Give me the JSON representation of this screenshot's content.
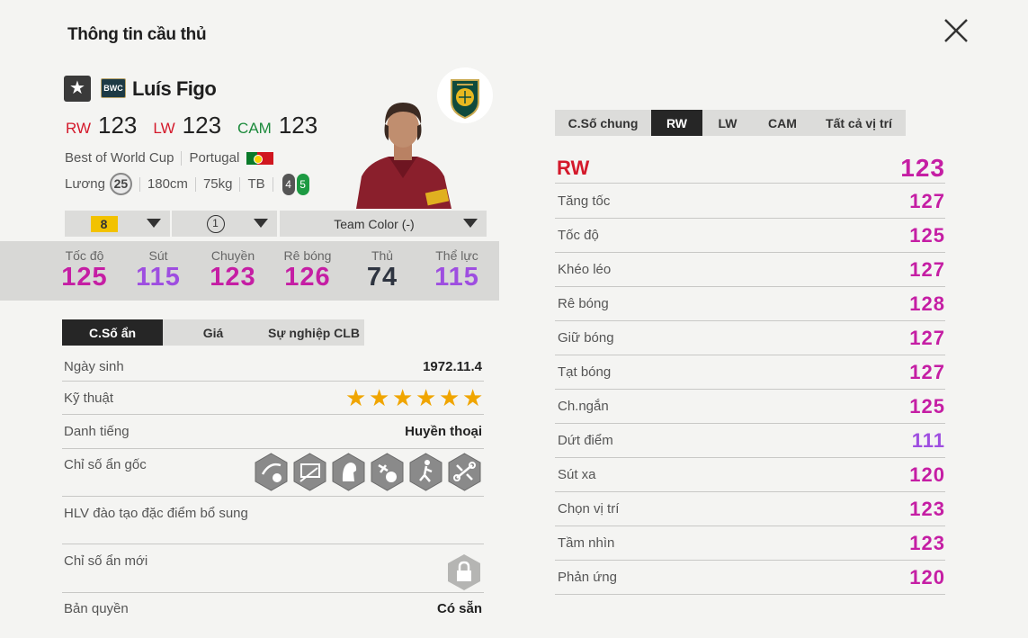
{
  "header": {
    "title": "Thông tin cầu thủ"
  },
  "player": {
    "star_icon": "star-icon",
    "season_badge": "BWC",
    "name": "Luís Figo",
    "positions": [
      {
        "pos": "RW",
        "ovr": "123",
        "color": "#d4192b"
      },
      {
        "pos": "LW",
        "ovr": "123",
        "color": "#d4192b"
      },
      {
        "pos": "CAM",
        "ovr": "123",
        "color": "#1c8a3c"
      }
    ],
    "season": "Best of World Cup",
    "nation": "Portugal",
    "salary_label": "Lương",
    "salary": "25",
    "height": "180cm",
    "weight": "75kg",
    "body_type": "TB",
    "weak_foot": "4",
    "strong_foot": "5"
  },
  "selectors": {
    "upgrade_grade": "8",
    "level": "1",
    "team_color": "Team Color (-)"
  },
  "main_stats": [
    {
      "label": "Tốc độ",
      "value": "125"
    },
    {
      "label": "Sút",
      "value": "115"
    },
    {
      "label": "Chuyền",
      "value": "123"
    },
    {
      "label": "Rê bóng",
      "value": "126"
    },
    {
      "label": "Thủ",
      "value": "74"
    },
    {
      "label": "Thể lực",
      "value": "115"
    }
  ],
  "left_tabs": [
    "C.Số ẩn",
    "Giá",
    "Sự nghiệp CLB"
  ],
  "info": {
    "birth_label": "Ngày sinh",
    "birth": "1972.11.4",
    "skill_label": "Kỹ thuật",
    "skill_stars": 6,
    "reputation_label": "Danh tiếng",
    "reputation": "Huyền thoại",
    "traits_label": "Chỉ số ẩn gốc",
    "coach_label": "HLV đào tạo đặc điểm bổ sung",
    "new_traits_label": "Chỉ số ẩn mới",
    "license_label": "Bản quyền",
    "license": "Có sẵn"
  },
  "right_tabs": [
    "C.Số chung",
    "RW",
    "LW",
    "CAM",
    "Tất cả vị trí"
  ],
  "position_detail": {
    "position": "RW",
    "ovr": "123",
    "attributes": [
      {
        "label": "Tăng tốc",
        "value": "127"
      },
      {
        "label": "Tốc độ",
        "value": "125"
      },
      {
        "label": "Khéo léo",
        "value": "127"
      },
      {
        "label": "Rê bóng",
        "value": "128"
      },
      {
        "label": "Giữ bóng",
        "value": "127"
      },
      {
        "label": "Tạt bóng",
        "value": "127"
      },
      {
        "label": "Ch.ngắn",
        "value": "125"
      },
      {
        "label": "Dứt điểm",
        "value": "111"
      },
      {
        "label": "Sút xa",
        "value": "120"
      },
      {
        "label": "Chọn vị trí",
        "value": "123"
      },
      {
        "label": "Tầm nhìn",
        "value": "123"
      },
      {
        "label": "Phản ứng",
        "value": "120"
      }
    ]
  },
  "colors": {
    "pink": "#c51ea4",
    "purple": "#9e4ee0",
    "red": "#d4192b",
    "green": "#1c8a3c"
  }
}
